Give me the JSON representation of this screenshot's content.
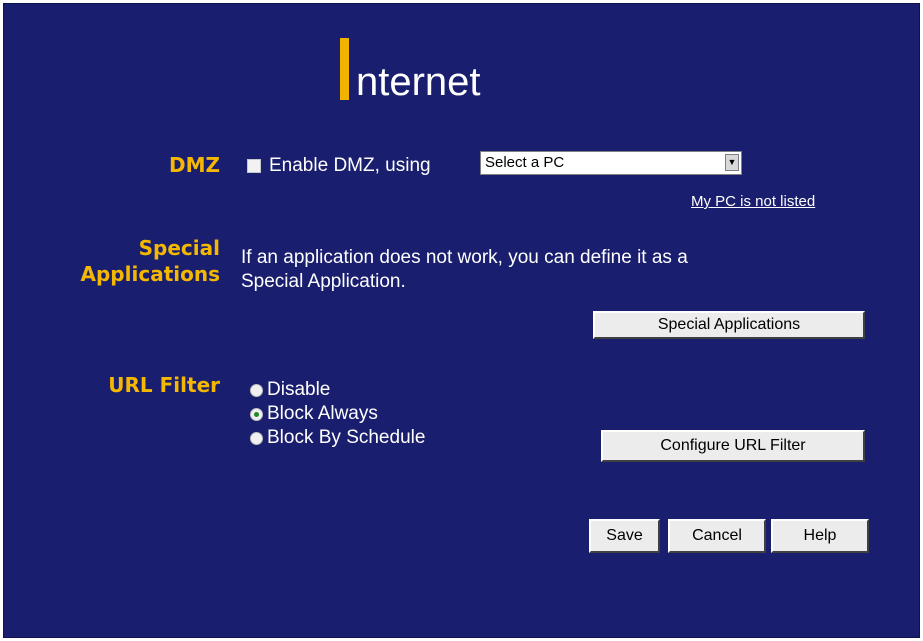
{
  "page": {
    "title": "nternet"
  },
  "dmz": {
    "label": "DMZ",
    "checkbox_label": "Enable DMZ, using",
    "checkbox_checked": false,
    "select_value": "Select a PC",
    "link_text": "My PC is not listed"
  },
  "special_apps": {
    "label_line1": "Special",
    "label_line2": "Applications",
    "description_line1": "If an application does not work, you can define it as a",
    "description_line2": "Special Application.",
    "button_label": "Special Applications"
  },
  "url_filter": {
    "label": "URL Filter",
    "options": [
      {
        "label": "Disable",
        "selected": false
      },
      {
        "label": "Block Always",
        "selected": true
      },
      {
        "label": "Block By Schedule",
        "selected": false
      }
    ],
    "configure_button_label": "Configure URL Filter"
  },
  "actions": {
    "save_label": "Save",
    "cancel_label": "Cancel",
    "help_label": "Help"
  },
  "colors": {
    "background": "#1a1e6e",
    "accent": "#f5b800",
    "text": "#ffffff"
  }
}
